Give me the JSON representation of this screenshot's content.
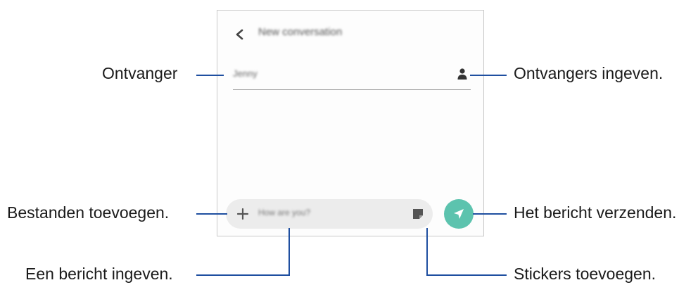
{
  "screen": {
    "title": "New conversation",
    "recipient_value": "Jenny",
    "message_placeholder": "How are you?"
  },
  "icons": {
    "back": "chevron-left-icon",
    "contact": "person-icon",
    "attach": "plus-icon",
    "sticker": "sticker-icon",
    "send": "send-icon"
  },
  "colors": {
    "send_button": "#5cc3ae",
    "callout_line": "#1f4fa0"
  },
  "callouts": {
    "recipient": "Ontvanger",
    "add_recipients": "Ontvangers ingeven.",
    "attach_files": "Bestanden toevoegen.",
    "send_message": "Het bericht verzenden.",
    "enter_message": "Een bericht ingeven.",
    "add_stickers": "Stickers toevoegen."
  }
}
